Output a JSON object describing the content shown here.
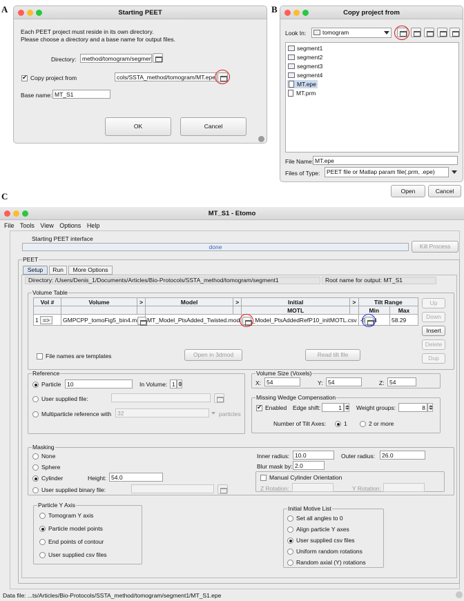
{
  "panel_labels": {
    "a": "A",
    "b": "B",
    "c": "C"
  },
  "panel_a": {
    "title": "Starting PEET",
    "intro_line1": "Each PEET project must reside in its own directory.",
    "intro_line2": "Please choose a directory and a base name for output files.",
    "directory_label": "Directory:",
    "directory_value": "method/tomogram/segment1",
    "copy_label": "Copy project from",
    "copy_value": "cols/SSTA_method/tomogram/MT.epe",
    "base_label": "Base name:",
    "base_value": "MT_S1",
    "ok_label": "OK",
    "cancel_label": "Cancel"
  },
  "panel_b": {
    "title": "Copy project from",
    "look_in_label": "Look In:",
    "look_in_value": "tomogram",
    "files": [
      "segment1",
      "segment2",
      "segment3",
      "segment4",
      "MT.epe",
      "MT.prm"
    ],
    "selected_file": "MT.epe",
    "file_name_label": "File Name:",
    "file_name_value": "MT.epe",
    "files_of_type_label": "Files of Type:",
    "files_of_type_value": "PEET file or Matlap param file(.prm, .epe)",
    "open_label": "Open",
    "cancel_label": "Cancel"
  },
  "panel_c": {
    "title": "MT_S1 - Etomo",
    "menu": [
      "File",
      "Tools",
      "View",
      "Options",
      "Help"
    ],
    "status_text": "Starting PEET interface",
    "progress_text": "done",
    "kill_label": "Kill Process",
    "peet_label": "PEET",
    "tabs": [
      "Setup",
      "Run",
      "More Options"
    ],
    "directory_text": "Directory:  /Users/Denis_1/Documents/Articles/Bio-Protocols/SSTA_method/tomogram/segment1",
    "root_text": "Root name for output:  MT_S1",
    "volume_table": {
      "title": "Volume Table",
      "h_vol": "Vol #",
      "h_volume": "Volume",
      "h_model": "Model",
      "h_initial": "Initial",
      "h_motl": "MOTL",
      "h_tilt": "Tilt Range",
      "h_min": "Min",
      "h_max": "Max",
      "arrow": ">",
      "row_num": "1",
      "row_btn": "=>",
      "row_volume": "GMPCPP_tomoFig5_bin4.mrc",
      "row_model": "MT_Model_PtsAdded_Twisted.mod",
      "row_motl": "MT_Model_PtsAddedRefP10_initMOTL.csv",
      "row_min": "-53.14",
      "row_max": "58.29",
      "side_buttons": [
        "Up",
        "Down",
        "Insert",
        "Delete",
        "Dup"
      ],
      "templates_label": "File names are templates",
      "open3dmod_label": "Open in 3dmod",
      "readtilt_label": "Read tilt file"
    },
    "reference": {
      "title": "Reference",
      "particle_label": "Particle",
      "particle_value": "10",
      "in_volume_label": "In Volume:",
      "in_volume_value": "1",
      "user_file_label": "User supplied file:",
      "multi_label": "Multiparticle reference with",
      "multi_value": "32",
      "particles_label": "particles"
    },
    "volume_size": {
      "title": "Volume Size (Voxels)",
      "x_label": "X:",
      "x_value": "54",
      "y_label": "Y:",
      "y_value": "54",
      "z_label": "Z:",
      "z_value": "54"
    },
    "wedge": {
      "title": "Missing Wedge Compensation",
      "enabled_label": "Enabled",
      "edge_label": "Edge shift:",
      "edge_value": "1",
      "weight_label": "Weight groups:",
      "weight_value": "8",
      "axes_label": "Number of Tilt Axes:",
      "opt1": "1",
      "opt2": "2 or more"
    },
    "masking": {
      "title": "Masking",
      "none": "None",
      "sphere": "Sphere",
      "cylinder": "Cylinder",
      "height_label": "Height:",
      "height_value": "54.0",
      "binary_label": "User supplied binary file:",
      "inner_label": "Inner radius:",
      "inner_value": "10.0",
      "outer_label": "Outer radius:",
      "outer_value": "26.0",
      "blur_label": "Blur mask by:",
      "blur_value": "2.0",
      "manual_label": "Manual Cylinder Orientation",
      "zrot_label": "Z Rotation:",
      "yrot_label": "Y Rotation:"
    },
    "yaxis": {
      "title": "Particle Y Axis",
      "options": [
        "Tomogram Y axis",
        "Particle model points",
        "End points of contour",
        "User supplied csv files"
      ]
    },
    "motive": {
      "title": "Initial Motive List",
      "options": [
        "Set all angles to 0",
        "Align particle Y axes",
        "User supplied csv files",
        "Uniform random rotations",
        "Random axial (Y) rotations"
      ]
    },
    "data_file": "Data file:  ...ts/Articles/Bio-Protocols/SSTA_method/tomogram/segment1/MT_S1.epe"
  }
}
